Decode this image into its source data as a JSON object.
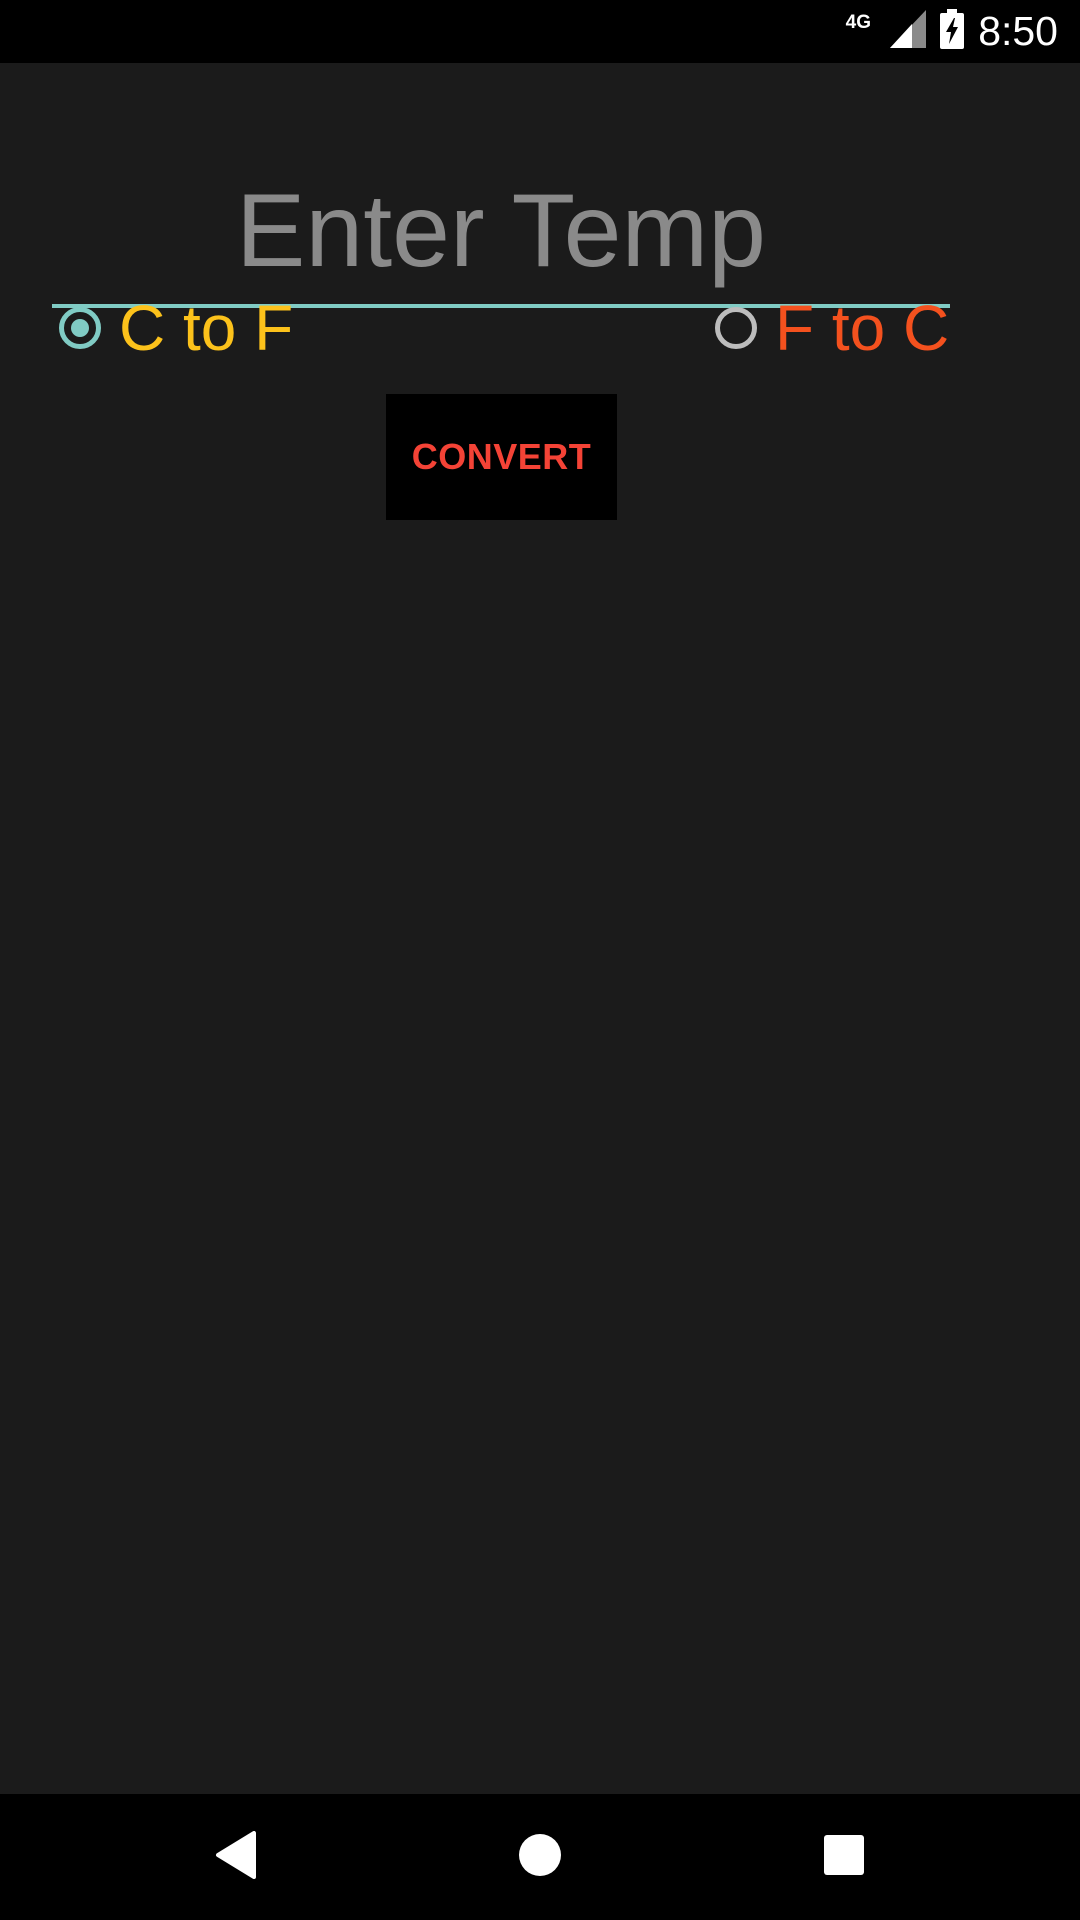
{
  "status_bar": {
    "network": "4G",
    "time": "8:50",
    "icons": [
      "signal-icon",
      "battery-charging-icon"
    ]
  },
  "form": {
    "temp_placeholder": "Enter Temp",
    "temp_value": "",
    "options": [
      {
        "label": "C to F",
        "checked": true,
        "color": "#fcc21b"
      },
      {
        "label": "F to C",
        "checked": false,
        "color": "#f4511e"
      }
    ],
    "convert_label": "CONVERT"
  },
  "nav_bar": {
    "icons": [
      "back-icon",
      "home-icon",
      "recents-icon"
    ]
  },
  "colors": {
    "background": "#1b1b1b",
    "accent": "#80cbc4",
    "button_text": "#f44336"
  }
}
